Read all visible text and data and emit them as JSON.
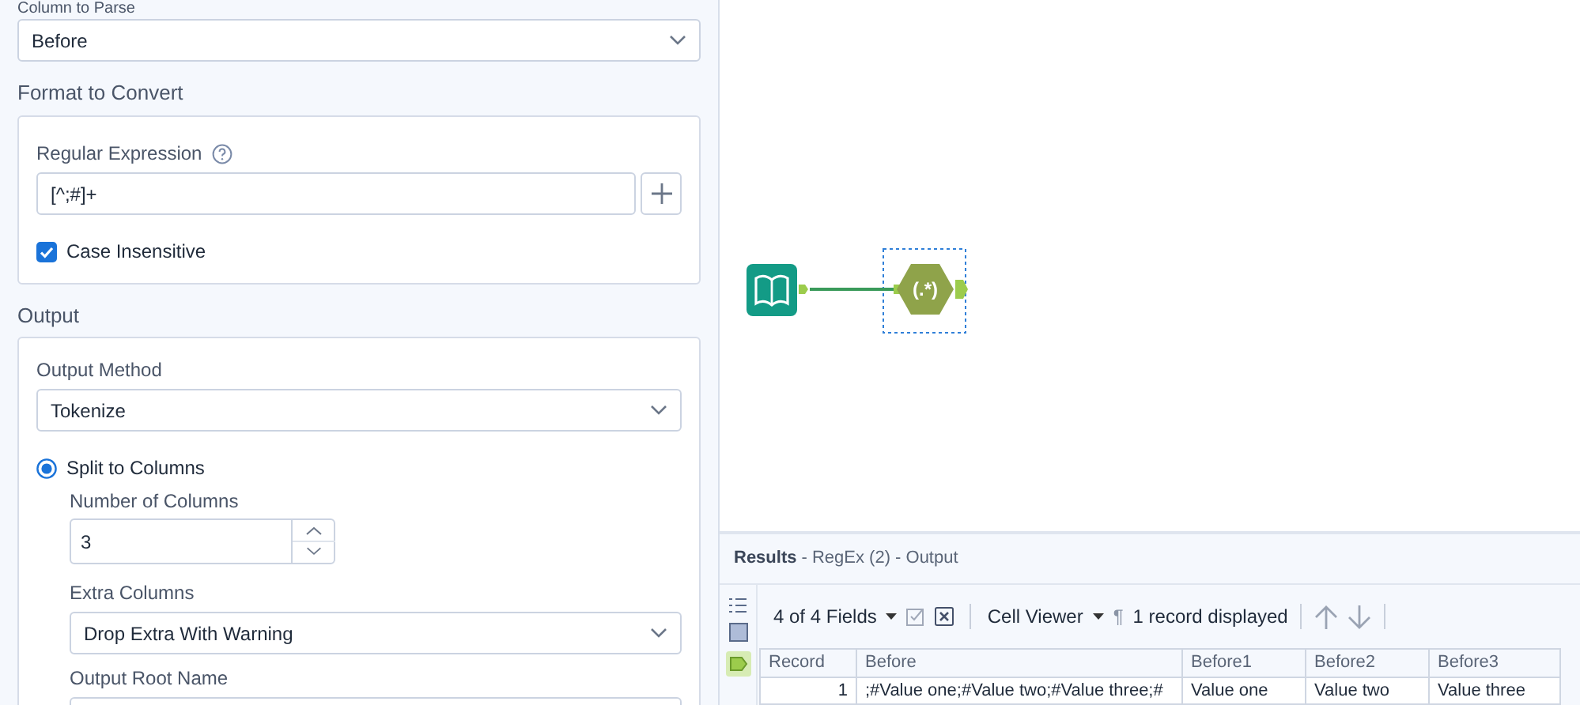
{
  "config": {
    "column_to_parse": {
      "label": "Column to Parse",
      "value": "Before"
    },
    "format_section": {
      "title": "Format to Convert",
      "regex_label": "Regular Expression",
      "regex_value": "[^;#]+",
      "case_insensitive": {
        "label": "Case Insensitive",
        "checked": true
      }
    },
    "output_section": {
      "title": "Output",
      "method_label": "Output Method",
      "method_value": "Tokenize",
      "options": [
        {
          "label": "Split to Columns",
          "selected": true
        }
      ],
      "number_of_columns": {
        "label": "Number of Columns",
        "value": "3"
      },
      "extra_columns": {
        "label": "Extra Columns",
        "value": "Drop Extra With Warning"
      },
      "output_root_name": {
        "label": "Output Root Name"
      }
    }
  },
  "canvas": {
    "tools": [
      {
        "kind": "input",
        "selected": false
      },
      {
        "kind": "regex",
        "selected": true,
        "glyph": "(.*)"
      }
    ]
  },
  "results": {
    "title": "Results",
    "subtitle": "- RegEx (2) - Output",
    "fields": "4 of 4 Fields",
    "viewer": "Cell Viewer",
    "pilcrow": "¶",
    "record_count": "1 record displayed",
    "table": {
      "columns": [
        "Record",
        "Before",
        "Before1",
        "Before2",
        "Before3"
      ],
      "rows": [
        [
          "1",
          ";#Value one;#Value two;#Value three;#",
          "Value one",
          "Value two",
          "Value three"
        ]
      ]
    }
  }
}
